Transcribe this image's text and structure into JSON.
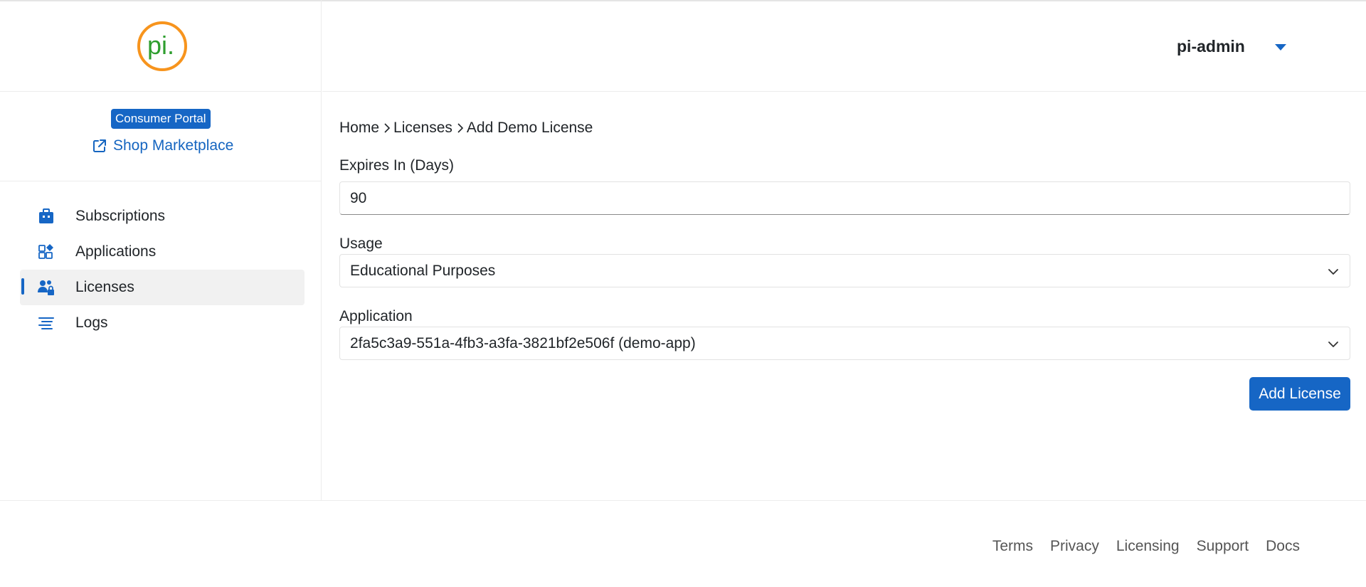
{
  "app": {
    "logo_text": "pi.",
    "colors": {
      "accent": "#1666c5",
      "logo_ring": "#f7941d",
      "logo_text": "#2e9e2e",
      "logo_dot": "#1a8fd8"
    }
  },
  "sidebar": {
    "portal_badge": "Consumer Portal",
    "shop_link": {
      "label": "Shop Marketplace",
      "icon": "external-link-icon"
    },
    "items": [
      {
        "label": "Subscriptions",
        "icon": "briefcase-icon",
        "active": false
      },
      {
        "label": "Applications",
        "icon": "apps-icon",
        "active": false
      },
      {
        "label": "Licenses",
        "icon": "users-lock-icon",
        "active": true
      },
      {
        "label": "Logs",
        "icon": "list-lines-icon",
        "active": false
      }
    ]
  },
  "header": {
    "user_name": "pi-admin",
    "user_menu_icon": "caret-down-icon"
  },
  "breadcrumb": {
    "items": [
      "Home",
      "Licenses",
      "Add Demo License"
    ]
  },
  "form": {
    "expires": {
      "label": "Expires In (Days)",
      "value": "90"
    },
    "usage": {
      "label": "Usage",
      "value": "Educational Purposes"
    },
    "application": {
      "label": "Application",
      "value": "2fa5c3a9-551a-4fb3-a3fa-3821bf2e506f (demo-app)"
    },
    "submit_label": "Add License"
  },
  "footer": {
    "links": [
      "Terms",
      "Privacy",
      "Licensing",
      "Support",
      "Docs"
    ]
  }
}
